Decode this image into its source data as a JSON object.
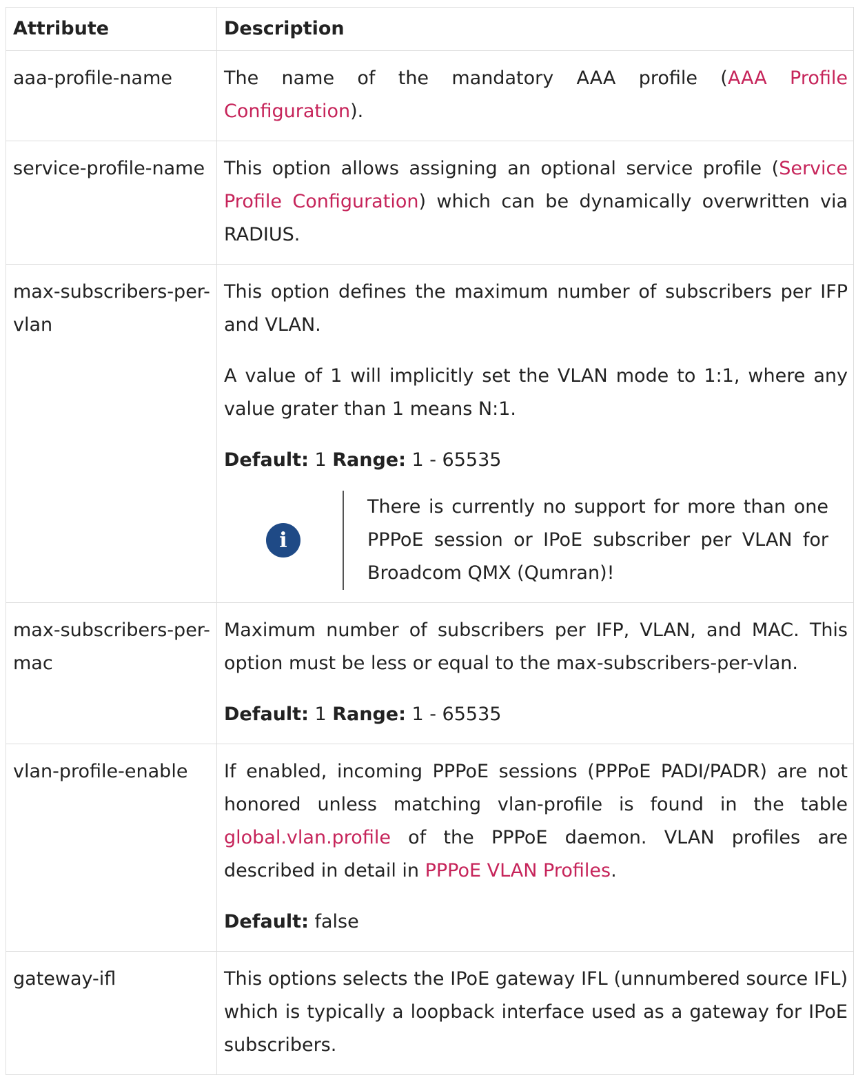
{
  "table": {
    "headers": [
      "Attribute",
      "Description"
    ],
    "rows": [
      {
        "attribute": "aaa-profile-name",
        "p1": {
          "pre": "The name of the mandatory AAA profile (",
          "link": "AAA Profile Configuration",
          "post": ")."
        }
      },
      {
        "attribute": "service-profile-name",
        "p1": {
          "pre": "This option allows assigning an optional service profile (",
          "link": "Service Profile Configuration",
          "post": ") which can be dynamically overwritten via RADIUS."
        }
      },
      {
        "attribute": "max-subscribers-per-vlan",
        "p1": "This option defines the maximum number of subscribers per IFP and VLAN.",
        "p2": "A value of 1 will implicitly set the VLAN mode to 1:1, where any value grater than 1 means N:1.",
        "default_label": "Default:",
        "default_value": " 1 ",
        "range_label": "Range:",
        "range_value": " 1 - 65535",
        "note": "There is currently no support for more than one PPPoE session or IPoE subscriber per VLAN for Broadcom QMX (Qumran)!",
        "note_icon": "info-icon"
      },
      {
        "attribute": "max-subscribers-per-mac",
        "p1": "Maximum number of subscribers per IFP, VLAN, and MAC. This option must be less or equal to the max-subscribers-per-vlan.",
        "default_label": "Default:",
        "default_value": " 1 ",
        "range_label": "Range:",
        "range_value": " 1 - 65535"
      },
      {
        "attribute": "vlan-profile-enable",
        "p1": {
          "pre": "If enabled, incoming PPPoE sessions (PPPoE PADI/PADR) are not honored unless matching vlan-profile is found in the table ",
          "link": "global.vlan.profile",
          "mid": " of the PPPoE daemon. VLAN profiles are described in detail in ",
          "link2": "PPPoE VLAN Profiles",
          "post": "."
        },
        "default_label": "Default:",
        "default_value": " false"
      },
      {
        "attribute": "gateway-ifl",
        "p1": "This options selects the IPoE gateway IFL (unnumbered source IFL) which is typically a loopback interface used as a gateway for IPoE subscribers."
      }
    ]
  },
  "colors": {
    "link": "#c6245a",
    "border": "#dddddd",
    "icon_bg": "#1f4a86"
  }
}
